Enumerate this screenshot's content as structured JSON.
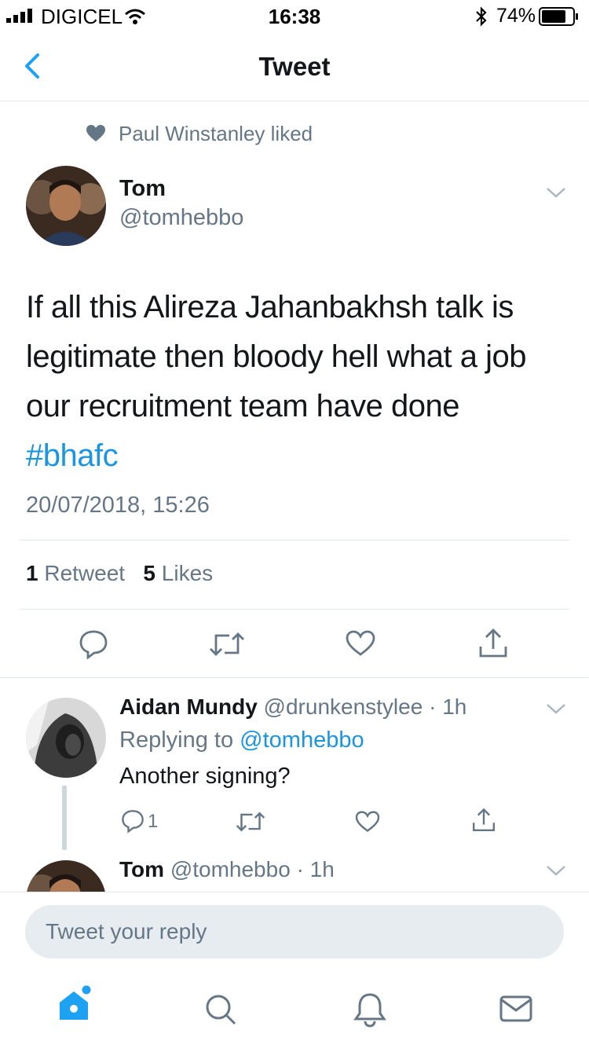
{
  "status_bar": {
    "carrier": "DIGICEL",
    "time": "16:38",
    "battery": "74%"
  },
  "nav": {
    "title": "Tweet"
  },
  "social_context": "Paul Winstanley liked",
  "tweet": {
    "author_name": "Tom",
    "author_handle": "@tomhebbo",
    "text": "If all this Alireza Jahanbakhsh talk is legitimate then bloody hell what a job our recruitment team have done",
    "hashtag": "#bhafc",
    "timestamp": "20/07/2018, 15:26",
    "retweet_count": "1",
    "retweet_label": "Retweet",
    "like_count": "5",
    "like_label": "Likes"
  },
  "replies": [
    {
      "author_name": "Aidan Mundy",
      "author_handle": "@drunkenstylee",
      "time": "· 1h",
      "replying_prefix": "Replying to",
      "replying_to": "@tomhebbo",
      "text": "Another signing?",
      "reply_count": "1"
    },
    {
      "author_name": "Tom",
      "author_handle": "@tomhebbo",
      "time": "· 1h"
    }
  ],
  "composer": {
    "placeholder": "Tweet your reply"
  },
  "colors": {
    "accent": "#1da1f2",
    "link": "#1b95e0",
    "muted": "#657786",
    "border": "#e1e8ed"
  },
  "icons": [
    "chevron-left-icon",
    "heart-icon",
    "chevron-down-icon",
    "reply-icon",
    "retweet-icon",
    "like-icon",
    "share-icon",
    "home-icon",
    "search-icon",
    "notifications-icon",
    "messages-icon"
  ]
}
